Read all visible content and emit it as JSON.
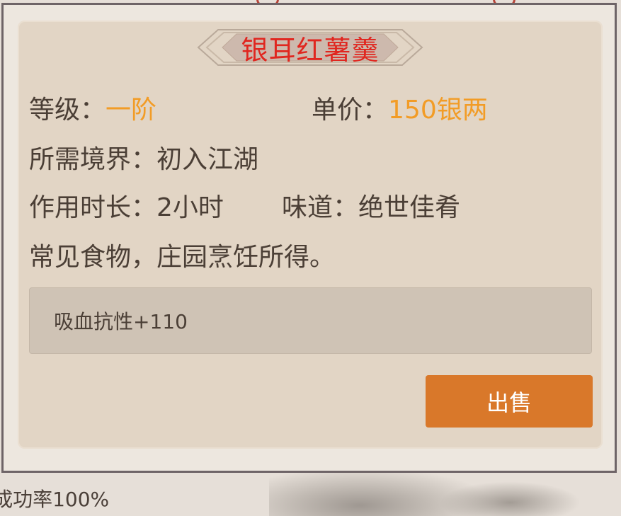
{
  "item": {
    "name": "银耳红薯羹",
    "grade_label": "等级：",
    "grade_value": "一阶",
    "price_label": "单价：",
    "price_value": "150银两",
    "realm_label": "所需境界：",
    "realm_value": "初入江湖",
    "duration_label": "作用时长：",
    "duration_value": "2小时",
    "taste_label": "味道：",
    "taste_value": "绝世佳肴",
    "description": "常见食物，庄园烹饪所得。",
    "effect": "吸血抗性+110"
  },
  "actions": {
    "sell_label": "出售"
  },
  "background": {
    "partial_text": "成功率100%"
  },
  "colors": {
    "title": "#e0261f",
    "highlight": "#f29c26",
    "sell_button": "#d9782a"
  }
}
